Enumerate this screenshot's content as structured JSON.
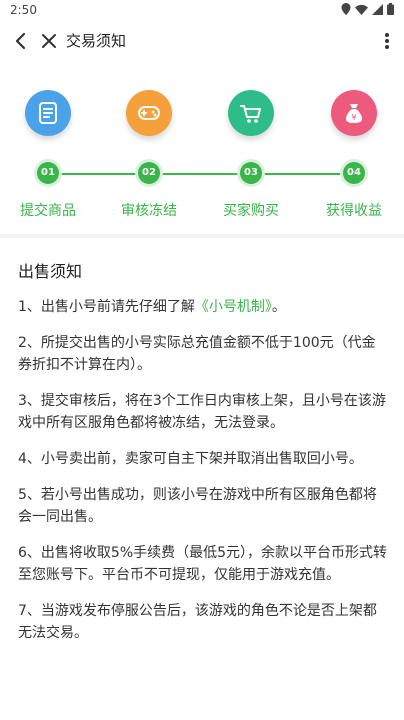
{
  "status_bar": {
    "time": "2:50"
  },
  "nav": {
    "title": "交易须知"
  },
  "process": {
    "steps": [
      {
        "num": "01",
        "label": "提交商品",
        "color": "#4aa3e8"
      },
      {
        "num": "02",
        "label": "审核冻结",
        "color": "#f5a03a"
      },
      {
        "num": "03",
        "label": "买家购买",
        "color": "#2ebd8a"
      },
      {
        "num": "04",
        "label": "获得收益",
        "color": "#ee5a7e"
      }
    ]
  },
  "notice": {
    "title": "出售须知",
    "items": [
      {
        "before": "1、出售小号前请先仔细了解",
        "link": "《小号机制》",
        "after": "。"
      },
      {
        "text": "2、所提交出售的小号实际总充值金额不低于100元（代金券折扣不计算在内）。"
      },
      {
        "text": "3、提交审核后，将在3个工作日内审核上架，且小号在该游戏中所有区服角色都将被冻结，无法登录。"
      },
      {
        "text": "4、小号卖出前，卖家可自主下架并取消出售取回小号。"
      },
      {
        "text": "5、若小号出售成功，则该小号在游戏中所有区服角色都将会一同出售。"
      },
      {
        "text": "6、出售将收取5%手续费（最低5元），余款以平台币形式转至您账号下。平台币不可提现，仅能用于游戏充值。"
      },
      {
        "text": "7、当游戏发布停服公告后，该游戏的角色不论是否上架都无法交易。"
      }
    ]
  },
  "colors": {
    "accent": "#39b54a"
  }
}
